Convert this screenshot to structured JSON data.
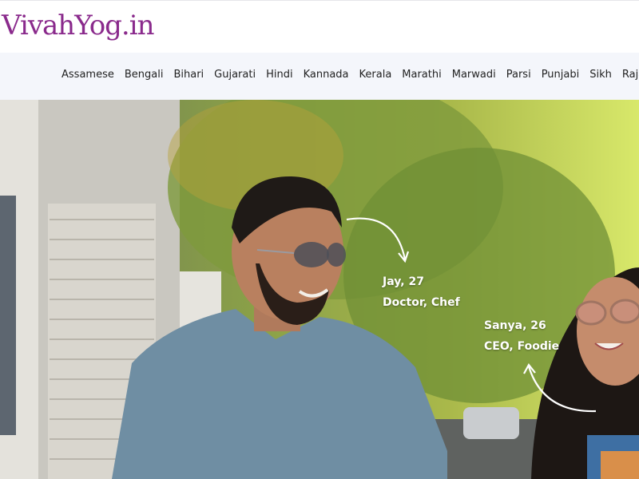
{
  "header": {
    "logo_text": "VivahYog.in"
  },
  "nav": {
    "items": [
      "Assamese",
      "Bengali",
      "Bihari",
      "Gujarati",
      "Hindi",
      "Kannada",
      "Kerala",
      "Marathi",
      "Marwadi",
      "Parsi",
      "Punjabi",
      "Sikh",
      "Rajastha"
    ]
  },
  "hero": {
    "person_one": {
      "name_age": "Jay, 27",
      "tagline": "Doctor, Chef"
    },
    "person_two": {
      "name_age": "Sanya, 26",
      "tagline": "CEO, Foodie"
    }
  },
  "colors": {
    "brand": "#8a2a8c",
    "nav_bg": "#f4f6fb",
    "caption": "#ffffff"
  }
}
